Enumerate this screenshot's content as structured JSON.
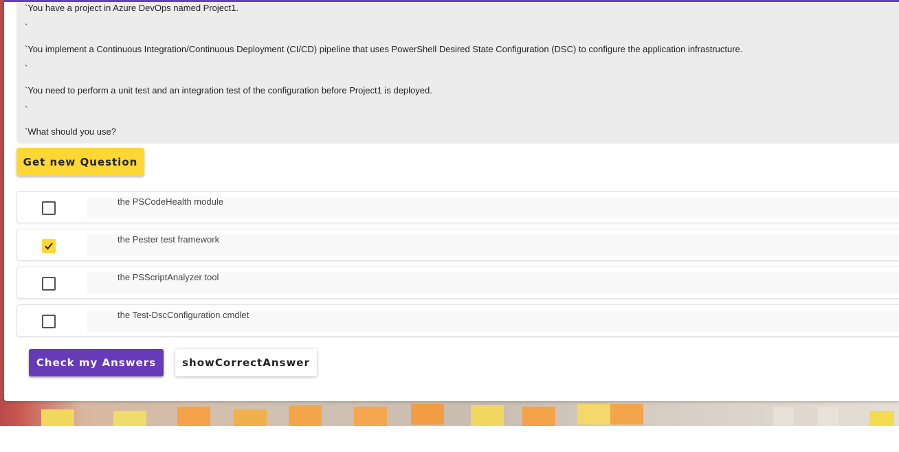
{
  "question": {
    "lines": [
      "`You have a project in Azure DevOps named Project1.",
      "`",
      "`You implement a Continuous Integration/Continuous Deployment (CI/CD) pipeline that uses PowerShell Desired State Configuration (DSC) to configure the application infrastructure.",
      "`",
      "`You need to perform a unit test and an integration test of the configuration before Project1 is deployed.",
      "`",
      "`What should you use?"
    ]
  },
  "buttons": {
    "new_question": "Get new Question",
    "check_answers": "Check my Answers",
    "show_correct": "showCorrectAnswer"
  },
  "options": [
    {
      "label": "the PSCodeHealth module",
      "checked": false
    },
    {
      "label": "the Pester test framework",
      "checked": true
    },
    {
      "label": "the PSScriptAnalyzer tool",
      "checked": false
    },
    {
      "label": "the Test-DscConfiguration cmdlet",
      "checked": false
    }
  ],
  "colors": {
    "accent": "#673ab7",
    "highlight": "#fdd835"
  }
}
